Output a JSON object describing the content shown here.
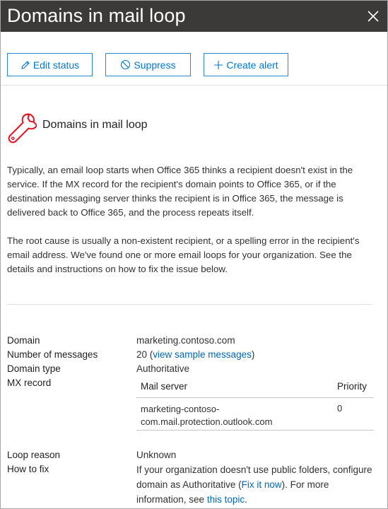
{
  "panel": {
    "title": "Domains in mail loop"
  },
  "toolbar": {
    "edit_status": "Edit status",
    "suppress": "Suppress",
    "create_alert": "Create alert"
  },
  "section": {
    "title": "Domains in mail loop",
    "paragraph1": "Typically, an email loop starts when Office 365 thinks a recipient doesn't exist in the service. If the MX record for the recipient's domain points to Office 365, or if the destination messaging server thinks the recipient is in Office 365, the message is delivered back to Office 365, and the process repeats itself.",
    "paragraph2": "The root cause is usually a non-existent recipient, or a spelling error in the recipient's email address. We've found one or more email loops for your organization. See the details and instructions on how to fix the issue below."
  },
  "details": {
    "domain_label": "Domain",
    "domain_value": "marketing.contoso.com",
    "messages_label": "Number of messages",
    "messages_count": "20",
    "messages_open": " (",
    "messages_link": "view sample messages",
    "messages_close": ")",
    "type_label": "Domain type",
    "type_value": "Authoritative",
    "mx_label": "MX record",
    "mx_table": {
      "col_server": "Mail server",
      "col_priority": "Priority",
      "rows": [
        {
          "server": "marketing-contoso-com.mail.protection.outlook.com",
          "priority": "0"
        }
      ]
    },
    "loop_label": "Loop reason",
    "loop_value": "Unknown",
    "fix_label": "How to fix",
    "fix_text_1": "If your organization doesn't use public folders, configure domain as Authoritative (",
    "fix_link_1": "Fix it now",
    "fix_text_2": "). For more information, see ",
    "fix_link_2": "this topic",
    "fix_text_3": "."
  }
}
